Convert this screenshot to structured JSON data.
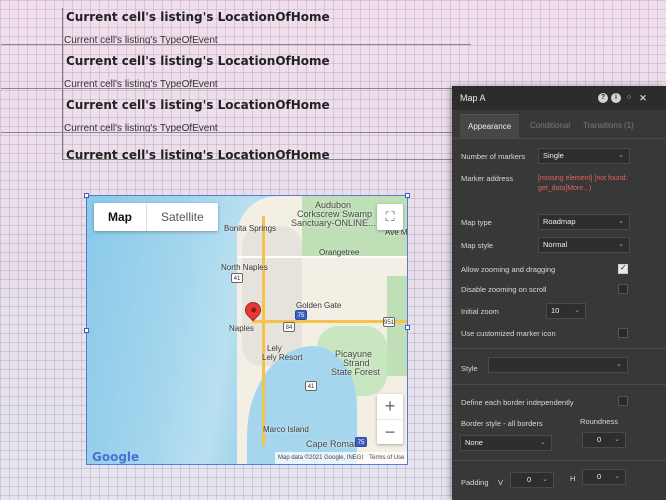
{
  "repeating_group": {
    "cells": [
      {
        "location": "Current cell's listing's LocationOfHome",
        "type": "Current cell's listing's TypeOfEvent"
      },
      {
        "location": "Current cell's listing's LocationOfHome",
        "type": "Current cell's listing's TypeOfEvent"
      },
      {
        "location": "Current cell's listing's LocationOfHome",
        "type": "Current cell's listing's TypeOfEvent"
      },
      {
        "location": "Current cell's listing's LocationOfHome",
        "type": "Current cell's listing's TypeOfEvent"
      }
    ]
  },
  "map": {
    "type_buttons": {
      "map": "Map",
      "satellite": "Satellite"
    },
    "places": {
      "audubon": "Audubon",
      "corkscrew": "Corkscrew Swamp",
      "sanctuary": "Sanctuary-ONLINE...",
      "bonita": "Bonita Springs",
      "orangetree": "Orangetree",
      "north_naples": "North Naples",
      "golden_gate": "Golden Gate",
      "naples": "Naples",
      "lely": "Lely",
      "lely_resort": "Lely Resort",
      "picayune": "Picayune",
      "strand": "Strand",
      "state_forest": "State Forest",
      "marco": "Marco Island",
      "cape_romano": "Cape Romano",
      "ave_ma": "Ave Ma"
    },
    "shields": {
      "s41a": "41",
      "s75a": "75",
      "s84": "84",
      "s951": "951",
      "s41b": "41",
      "s75b": "75"
    },
    "zoom_in": "+",
    "zoom_out": "−",
    "fullscreen_glyph": "⛶",
    "logo": "Google",
    "attribution": "Map data ©2021 Google, INEGI",
    "terms": "Terms of Use"
  },
  "panel": {
    "title": "Map A",
    "icons": {
      "help": "?",
      "info": "i",
      "comment": "○",
      "close": "✕"
    },
    "tabs": {
      "appearance": "Appearance",
      "conditional": "Conditional",
      "transitions": "Transitions (1)"
    },
    "number_of_markers": {
      "label": "Number of markers",
      "value": "Single"
    },
    "marker_address": {
      "label": "Marker address",
      "value": "[missing element] [not found: get_data]More...)"
    },
    "map_type": {
      "label": "Map type",
      "value": "Roadmap"
    },
    "map_style": {
      "label": "Map style",
      "value": "Normal"
    },
    "allow_zoom": {
      "label": "Allow zooming and dragging",
      "checked": true
    },
    "disable_scroll": {
      "label": "Disable zooming on scroll",
      "checked": false
    },
    "initial_zoom": {
      "label": "Initial zoom",
      "value": "10"
    },
    "custom_marker": {
      "label": "Use customized marker icon",
      "checked": false
    },
    "style": {
      "label": "Style",
      "value": ""
    },
    "border_independent": {
      "label": "Define each border independently",
      "checked": false
    },
    "border_style": {
      "label": "Border style - all borders",
      "value": "None"
    },
    "roundness": {
      "label": "Roundness",
      "value": "0"
    },
    "padding": {
      "label": "Padding",
      "v_label": "V",
      "v_value": "0",
      "h_label": "H",
      "h_value": "0"
    },
    "colors": {
      "panel_bg": "#383838",
      "error": "#e46060"
    }
  }
}
